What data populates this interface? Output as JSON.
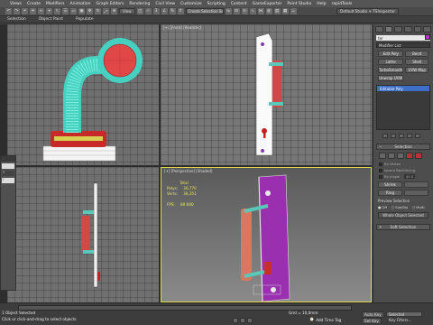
{
  "menu": [
    "Views",
    "Create",
    "Modifiers",
    "Animation",
    "Graph Editors",
    "Rendering",
    "Civil View",
    "Customize",
    "Scripting",
    "Content",
    "GameExporter",
    "Point Studio",
    "Help",
    "rapidTools"
  ],
  "toolbar": {
    "view_dropdown": "View",
    "selection_set": "Create Selection Se",
    "workspace": "Default Studio + TSInspector"
  },
  "ribbon": [
    "Selection",
    "Object Paint",
    "Populate"
  ],
  "viewports": {
    "top_right_label": "[+] [Front] [Realistic]",
    "bottom_right_label": "[+] [Perspective] [Shaded]",
    "stats": {
      "total_label": "Total",
      "polys_label": "Polys:",
      "polys_value": "30,770",
      "verts_label": "Verts:",
      "verts_value": "30,351",
      "fps_label": "FPS:",
      "fps_value": "89.660"
    }
  },
  "floatpanel": {
    "cells": [
      "",
      "Y",
      "I"
    ]
  },
  "command_panel": {
    "object_name": "ter",
    "modifier_list": "Modifier List",
    "buttons": [
      "Edit Poly",
      "Bend",
      "Lathe",
      "Shell",
      "TurboSmooth",
      "UVW Map",
      "Unwrap UVW"
    ],
    "stack_item": "Editable Poly",
    "selection_title": "Selection",
    "checks": [
      "By Vertex",
      "Ignore Backfacing",
      "By Angle",
      "Shrink",
      "Ring"
    ],
    "angle_value": "45.0",
    "preview_title": "Preview Selection",
    "radio_off": "Off",
    "radio_subobj": "SubObj",
    "radio_multi": "Multi",
    "whole_object": "Whole Object Selected",
    "soft_selection": "Soft Selection"
  },
  "status": {
    "prompt1": "1 Object Selected",
    "prompt2": "Click or click-and-drag to select objects",
    "grid": "Grid = 10,0mm",
    "add_time_tag": "Add Time Tag",
    "auto_key": "Auto Key",
    "selected": "Selected",
    "set_key": "Set Key",
    "key_filters": "Key Filters..."
  },
  "colors": {
    "accent_border": "#e0d848",
    "object_color": "#b535c8",
    "stats_text": "#e6e650"
  }
}
